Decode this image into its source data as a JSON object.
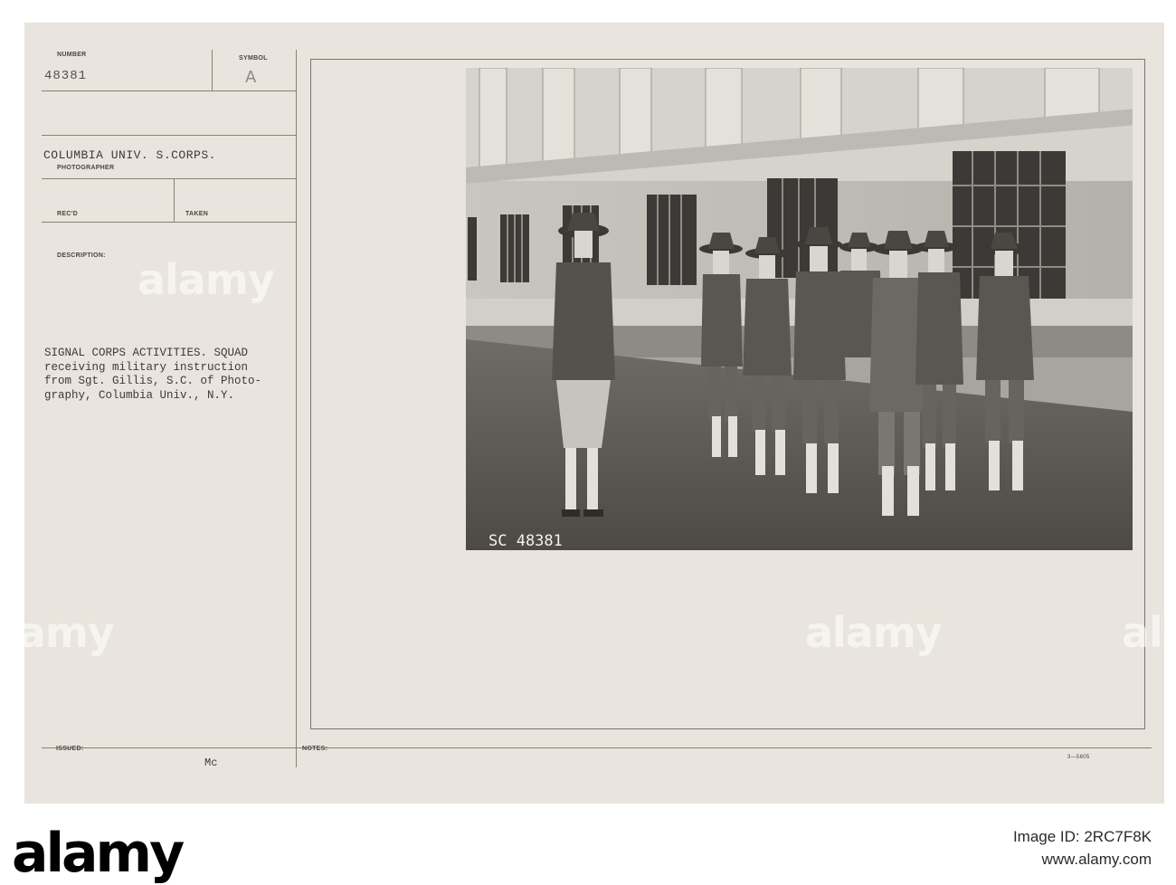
{
  "card": {
    "number_label": "NUMBER",
    "number_value": "48381",
    "symbol_label": "SYMBOL",
    "symbol_value": "A",
    "photographer_value": "COLUMBIA UNIV. S.CORPS.",
    "photographer_label": "PHOTOGRAPHER",
    "recd_label": "REC'D",
    "taken_label": "TAKEN",
    "description_label": "DESCRIPTION:",
    "description_text": "SIGNAL CORPS ACTIVITIES. SQUAD\nreceiving military instruction\nfrom Sgt. Gillis, S.C. of Photo-\ngraphy, Columbia Univ., N.Y.",
    "issued_label": "ISSUED:",
    "issued_value": "Mc",
    "notes_label": "NOTES:",
    "form_code": "3—5605",
    "photo_stamp": "SC 48381"
  },
  "watermark": "alamy",
  "footer": {
    "logo": "alamy",
    "image_id_label": "Image ID: 2RC7F8K",
    "site": "www.alamy.com"
  }
}
